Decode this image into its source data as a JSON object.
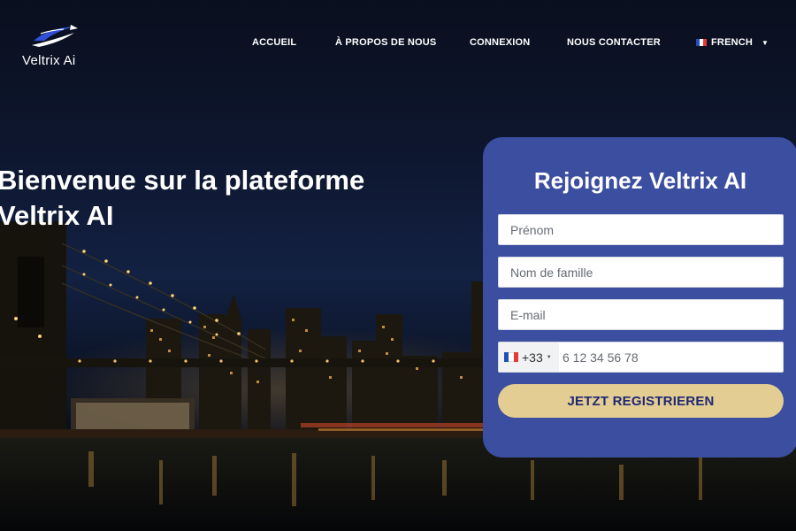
{
  "brand": {
    "name": "Veltrix Ai",
    "logo_icon": "swoosh-logo-icon"
  },
  "nav": {
    "items": [
      {
        "label": "ACCUEIL"
      },
      {
        "label": "À PROPOS DE NOUS"
      },
      {
        "label": "CONNEXION"
      },
      {
        "label": "NOUS CONTACTER"
      }
    ],
    "language": {
      "label": "FRENCH",
      "flag_icon": "france-flag-icon",
      "caret_icon": "caret-down-icon"
    }
  },
  "hero": {
    "title_line1": "Bienvenue sur la plateforme",
    "title_line2": "Veltrix AI"
  },
  "signup": {
    "title": "Rejoignez Veltrix AI",
    "first_name_placeholder": "Prénom",
    "last_name_placeholder": "Nom de famille",
    "email_placeholder": "E-mail",
    "phone": {
      "country_code": "+33",
      "placeholder": "6 12 34 56 78"
    },
    "submit_label": "JETZT REGISTRIEREN"
  },
  "colors": {
    "card_bg": "#3b4ea0",
    "button_bg": "#e3cd93",
    "button_text": "#1f2873",
    "logo_blue": "#2e4fd6"
  }
}
